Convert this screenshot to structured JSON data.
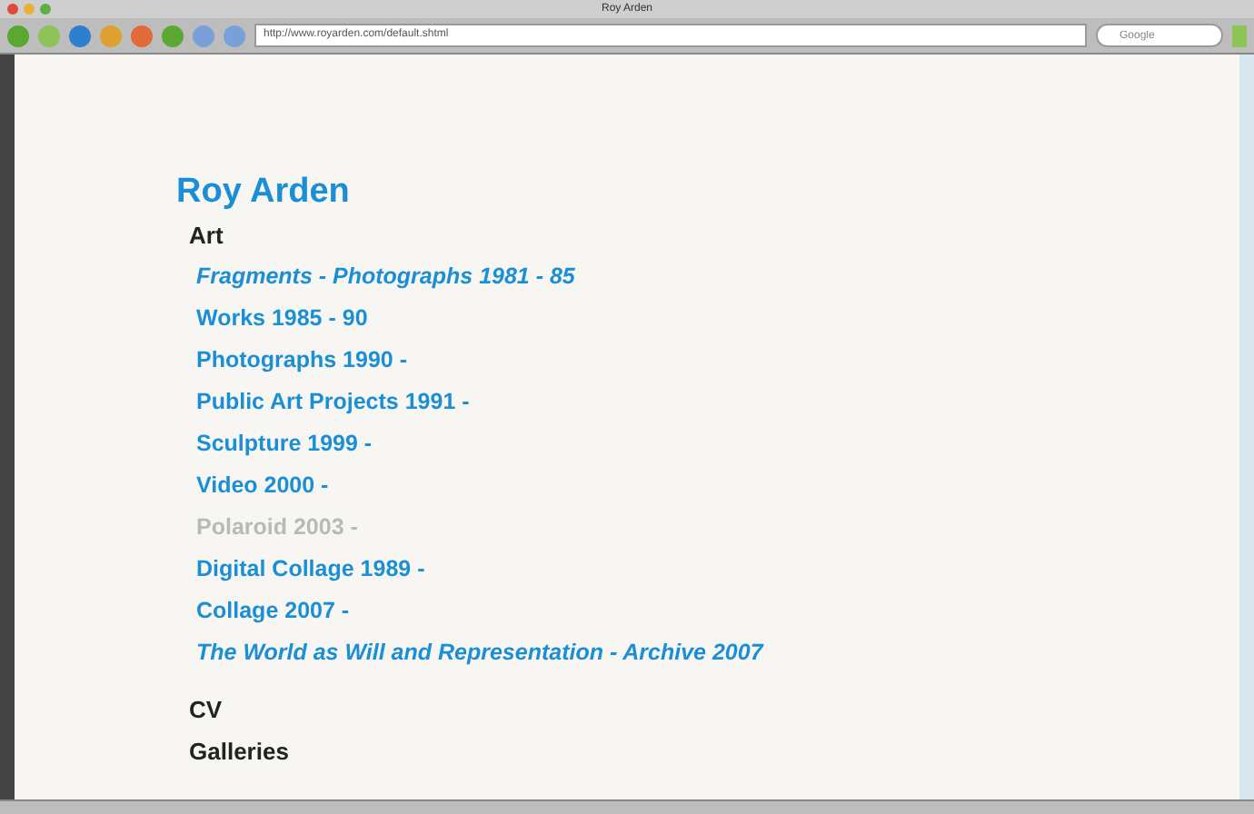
{
  "window": {
    "title": "Roy Arden"
  },
  "toolbar": {
    "url": "http://www.royarden.com/default.shtml",
    "search_placeholder": "Google"
  },
  "page": {
    "heading": "Roy Arden",
    "section": "Art",
    "items": [
      {
        "label": "Fragments - Photographs 1981 - 85",
        "kind": "italic",
        "disabled": false
      },
      {
        "label": "Works 1985 - 90",
        "kind": "plain",
        "disabled": false
      },
      {
        "label": "Photographs 1990 -",
        "kind": "plain",
        "disabled": false
      },
      {
        "label": "Public Art Projects 1991 -",
        "kind": "plain",
        "disabled": false
      },
      {
        "label": "Sculpture 1999 -",
        "kind": "plain",
        "disabled": false
      },
      {
        "label": "Video 2000 -",
        "kind": "plain",
        "disabled": false
      },
      {
        "label": "Polaroid 2003 -",
        "kind": "plain",
        "disabled": true
      },
      {
        "label": "Digital Collage 1989 -",
        "kind": "plain",
        "disabled": false
      },
      {
        "label": "Collage 2007 -",
        "kind": "plain",
        "disabled": false
      },
      {
        "label": "The World as Will and Representation - Archive 2007",
        "kind": "italic",
        "disabled": false
      }
    ],
    "sections": [
      "CV",
      "Galleries"
    ]
  }
}
